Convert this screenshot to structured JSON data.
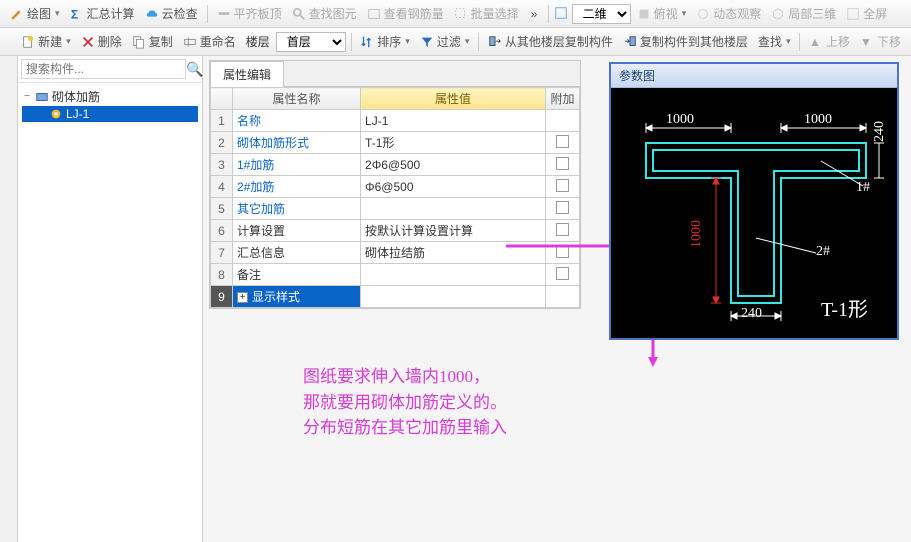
{
  "toolbar_top": {
    "drawing": "绘图",
    "summary": "汇总计算",
    "cloud": "云检查",
    "flat_top": "平齐板顶",
    "find_entity": "查找图元",
    "view_rebar": "查看钢筋量",
    "batch_select": "批量选择",
    "more": "»",
    "view_select": "二维",
    "top_view": "俯视",
    "dynamic": "动态观察",
    "local_3d": "局部三维",
    "fullscreen": "全屏"
  },
  "toolbar_second": {
    "new": "新建",
    "delete": "删除",
    "copy": "复制",
    "rename": "重命名",
    "floor": "楼层",
    "first_floor": "首层",
    "sort": "排序",
    "filter": "过滤",
    "copy_from_other": "从其他楼层复制构件",
    "copy_to_other": "复制构件到其他楼层",
    "find": "查找",
    "up": "上移",
    "down": "下移"
  },
  "search": {
    "placeholder": "搜索构件..."
  },
  "tree": {
    "root": "砌体加筋",
    "child": "LJ-1"
  },
  "prop_panel": {
    "tab": "属性编辑",
    "col_name": "属性名称",
    "col_val": "属性值",
    "col_attach": "附加",
    "rows": [
      {
        "n": "1",
        "name": "名称",
        "val": "LJ-1",
        "blue": true,
        "attach": false
      },
      {
        "n": "2",
        "name": "砌体加筋形式",
        "val": "T-1形",
        "blue": true,
        "attach": true
      },
      {
        "n": "3",
        "name": "1#加筋",
        "val": "2Φ6@500",
        "blue": true,
        "attach": true
      },
      {
        "n": "4",
        "name": "2#加筋",
        "val": "Φ6@500",
        "blue": true,
        "attach": true
      },
      {
        "n": "5",
        "name": "其它加筋",
        "val": "",
        "blue": true,
        "attach": true
      },
      {
        "n": "6",
        "name": "计算设置",
        "val": "按默认计算设置计算",
        "blue": false,
        "attach": true
      },
      {
        "n": "7",
        "name": "汇总信息",
        "val": "砌体拉结筋",
        "blue": false,
        "attach": true
      },
      {
        "n": "8",
        "name": "备注",
        "val": "",
        "blue": false,
        "attach": true
      },
      {
        "n": "9",
        "name": "显示样式",
        "val": "",
        "blue": false,
        "attach": false,
        "expand": true,
        "selected": true
      }
    ]
  },
  "diagram": {
    "title": "参数图",
    "dim1000a": "1000",
    "dim1000b": "1000",
    "dim1000c": "1000",
    "dim240a": "240",
    "dim240b": "240",
    "lbl1": "1#",
    "lbl2": "2#",
    "type": "T-1形"
  },
  "annotation": {
    "line1": "图纸要求伸入墙内1000，",
    "line2": "那就要用砌体加筋定义的。",
    "line3": "分布短筋在其它加筋里输入"
  }
}
